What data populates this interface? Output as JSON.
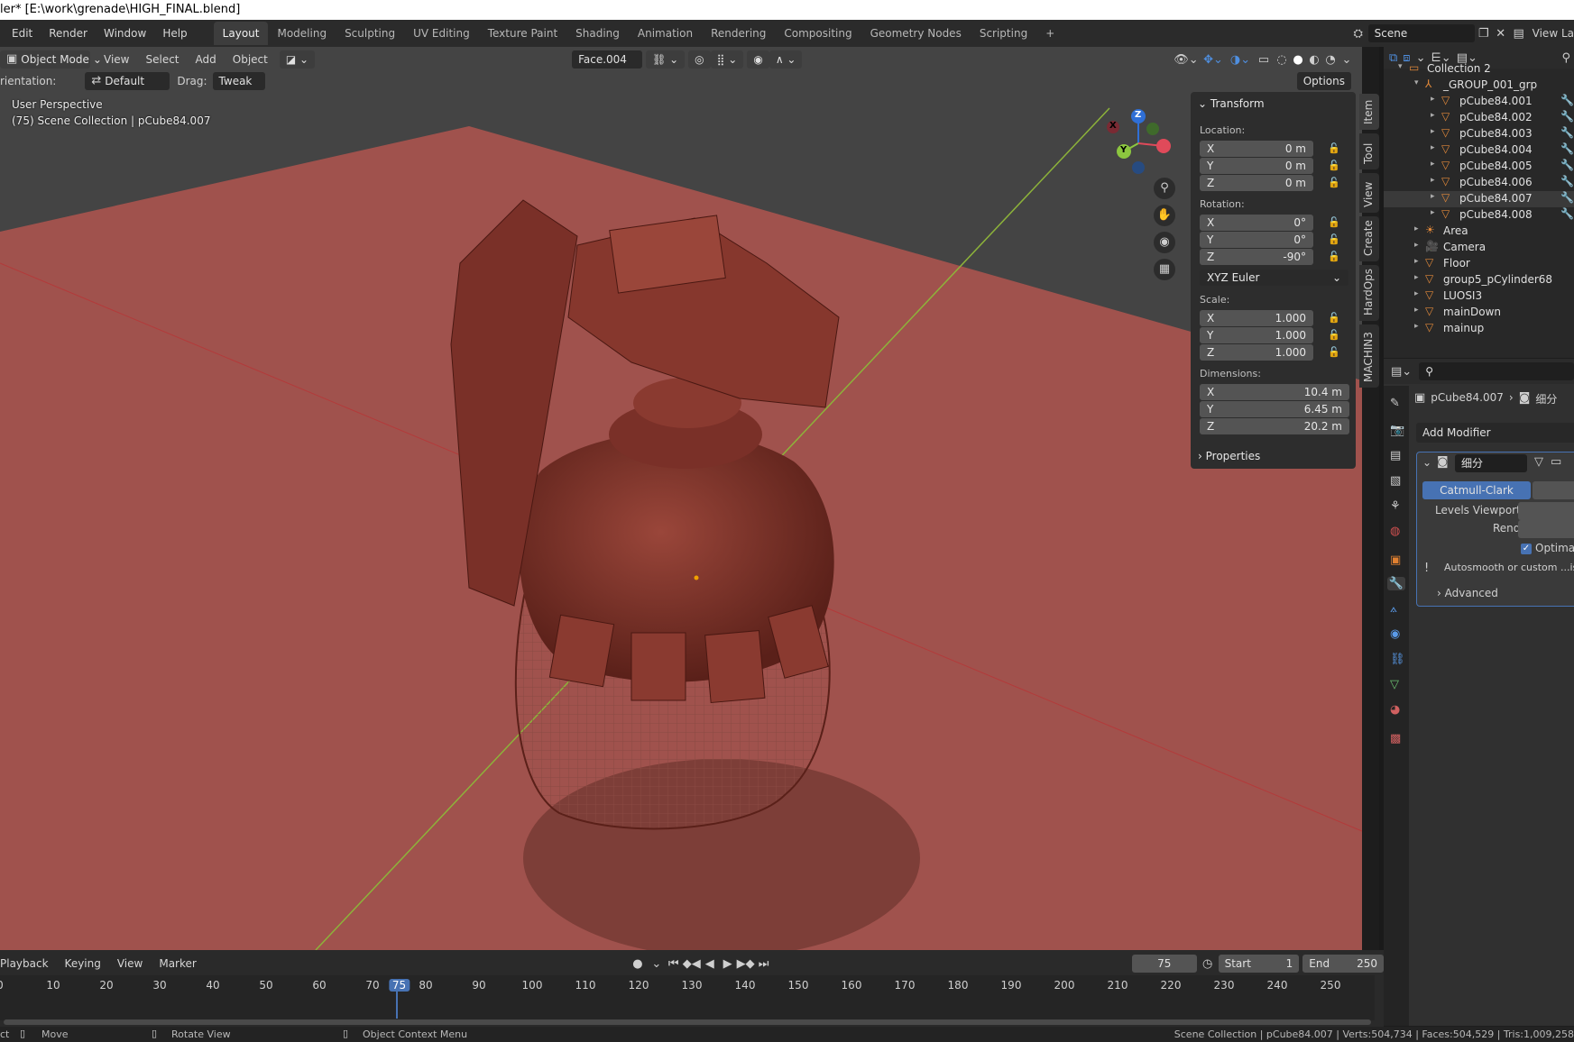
{
  "titlebar": {
    "title": "ler* [E:\\work\\grenade\\HIGH_FINAL.blend]"
  },
  "menus": [
    "Edit",
    "Render",
    "Window",
    "Help"
  ],
  "workspaces": [
    "Layout",
    "Modeling",
    "Sculpting",
    "UV Editing",
    "Texture Paint",
    "Shading",
    "Animation",
    "Rendering",
    "Compositing",
    "Geometry Nodes",
    "Scripting"
  ],
  "workspace_add": "+",
  "scene": {
    "name": "Scene",
    "view_layer": "View La"
  },
  "viewport_header": {
    "mode": "Object Mode",
    "menus": [
      "View",
      "Select",
      "Add",
      "Object"
    ],
    "face_select": "Face.004"
  },
  "tool_settings": {
    "orientation_label": "rientation:",
    "orientation_value": "Default",
    "drag_label": "Drag:",
    "drag_value": "Tweak",
    "options": "Options"
  },
  "overlay": {
    "perspective": "User Perspective",
    "collection_info": "(75) Scene Collection | pCube84.007"
  },
  "gizmo": {
    "z": "Z",
    "y": "Y",
    "x": "X"
  },
  "npanel": {
    "tabs": [
      "Item",
      "Tool",
      "View",
      "Create",
      "HardOps",
      "MACHIN3"
    ],
    "transform_title": "Transform",
    "location_label": "Location:",
    "location": [
      {
        "axis": "X",
        "value": "0 m"
      },
      {
        "axis": "Y",
        "value": "0 m"
      },
      {
        "axis": "Z",
        "value": "0 m"
      }
    ],
    "rotation_label": "Rotation:",
    "rotation": [
      {
        "axis": "X",
        "value": "0°"
      },
      {
        "axis": "Y",
        "value": "0°"
      },
      {
        "axis": "Z",
        "value": "-90°"
      }
    ],
    "rotation_mode": "XYZ Euler",
    "scale_label": "Scale:",
    "scale": [
      {
        "axis": "X",
        "value": "1.000"
      },
      {
        "axis": "Y",
        "value": "1.000"
      },
      {
        "axis": "Z",
        "value": "1.000"
      }
    ],
    "dimensions_label": "Dimensions:",
    "dimensions": [
      {
        "axis": "X",
        "value": "10.4 m"
      },
      {
        "axis": "Y",
        "value": "6.45 m"
      },
      {
        "axis": "Z",
        "value": "20.2 m"
      }
    ],
    "properties_title": "Properties"
  },
  "outliner": {
    "rows": [
      {
        "label": "Collection 2"
      },
      {
        "label": "_GROUP_001_grp"
      },
      {
        "label": "pCube84.001"
      },
      {
        "label": "pCube84.002"
      },
      {
        "label": "pCube84.003"
      },
      {
        "label": "pCube84.004"
      },
      {
        "label": "pCube84.005"
      },
      {
        "label": "pCube84.006"
      },
      {
        "label": "pCube84.007"
      },
      {
        "label": "pCube84.008"
      },
      {
        "label": "Area"
      },
      {
        "label": "Camera"
      },
      {
        "label": "Floor"
      },
      {
        "label": "group5_pCylinder68"
      },
      {
        "label": "LUOSI3"
      },
      {
        "label": "mainDown"
      },
      {
        "label": "mainup"
      }
    ]
  },
  "properties": {
    "object": "pCube84.007",
    "modifier_tab": "细分",
    "add_modifier": "Add Modifier",
    "modifier_name": "细分",
    "catmull": "Catmull-Clark",
    "levels_viewport": "Levels Viewport",
    "render": "Render",
    "optimal": "Optimal",
    "warning": "Autosmooth or custom ...isab",
    "advanced": "Advanced"
  },
  "timeline": {
    "menus": [
      "Playback",
      "Keying",
      "View",
      "Marker"
    ],
    "current_frame": "75",
    "start_label": "Start",
    "start": "1",
    "end_label": "End",
    "end": "250",
    "ticks": [
      "0",
      "10",
      "20",
      "30",
      "40",
      "50",
      "60",
      "70",
      "75",
      "80",
      "90",
      "100",
      "110",
      "120",
      "130",
      "140",
      "150",
      "160",
      "170",
      "180",
      "190",
      "200",
      "210",
      "220",
      "230",
      "240",
      "250"
    ]
  },
  "statusbar": {
    "select": "ct",
    "move": "Move",
    "rotate": "Rotate View",
    "context": "Object Context Menu",
    "stats": "Scene Collection | pCube84.007 | Verts:504,734 | Faces:504,529 | Tris:1,009,258"
  },
  "colors": {
    "accent": "#4772b3",
    "header": "#2b2b2b",
    "panel": "#2d2d2d",
    "floor": "#a0524d",
    "model": "#7a3028"
  }
}
